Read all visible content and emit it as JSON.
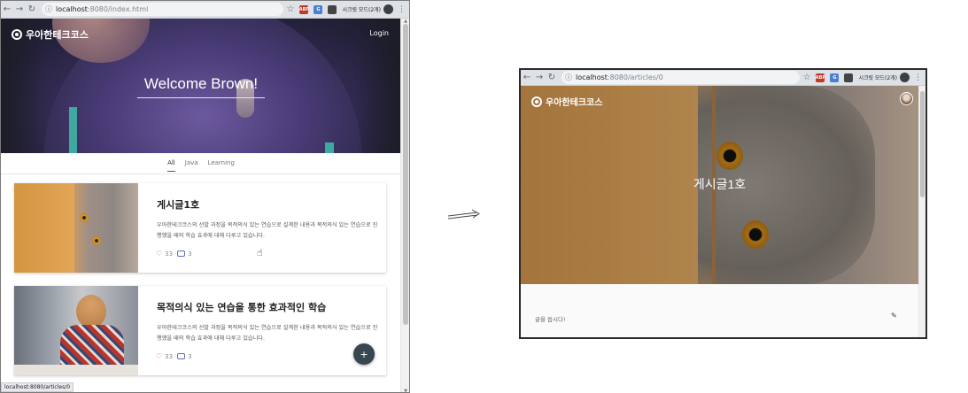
{
  "left_window": {
    "address": {
      "host": "localhost",
      "path": ":8080/index.html"
    },
    "incognito_label": "시크릿 모드(2개)",
    "extensions": [
      {
        "name": "abp",
        "text": "ABP",
        "color": "#c0392b"
      },
      {
        "name": "translate",
        "text": "G",
        "color": "#4a7fd6"
      },
      {
        "name": "ext3",
        "text": "",
        "color": "#444444"
      }
    ],
    "header": {
      "logo": "우아한테크코스",
      "login": "Login"
    },
    "hero": {
      "title": "Welcome Brown!"
    },
    "tabs": [
      {
        "label": "All",
        "active": true
      },
      {
        "label": "Java",
        "active": false
      },
      {
        "label": "Learning",
        "active": false
      }
    ],
    "cards": [
      {
        "title": "게시글1호",
        "description": "우아한테크코스의 선발 과정을 목적의식 있는 연습으로 설계한 내용과 목적의식 있는 연습으로 진행했을 때의 학습 효과에 대해 다루고 있습니다.",
        "likes": "33",
        "comments": "3",
        "image": "cat"
      },
      {
        "title": "목적의식 있는 연습을 통한 효과적인 학습",
        "description": "우아한테크코스의 선발 과정을 목적의식 있는 연습으로 설계한 내용과 목적의식 있는 연습으로 진행했을 때의 학습 효과에 대해 다루고 있습니다.",
        "likes": "33",
        "comments": "3",
        "image": "boy"
      }
    ],
    "fab": "+",
    "status_url": "localhost:8080/articles/0"
  },
  "right_window": {
    "address": {
      "host": "localhost",
      "path": ":8080/articles/0"
    },
    "incognito_label": "시크릿 모드(2개)",
    "header": {
      "logo": "우아한테크코스"
    },
    "article": {
      "title": "게시글1호"
    },
    "comment_placeholder": "글을 씁시다!"
  },
  "icons": {
    "back": "←",
    "forward": "→",
    "reload": "↻",
    "star": "☆",
    "menu": "⋮",
    "heart": "♡",
    "pencil": "✎",
    "cursor": "☝"
  },
  "colors": {
    "accent": "#3f51b5",
    "fab": "#37474f",
    "heart": "#e35a7a"
  }
}
